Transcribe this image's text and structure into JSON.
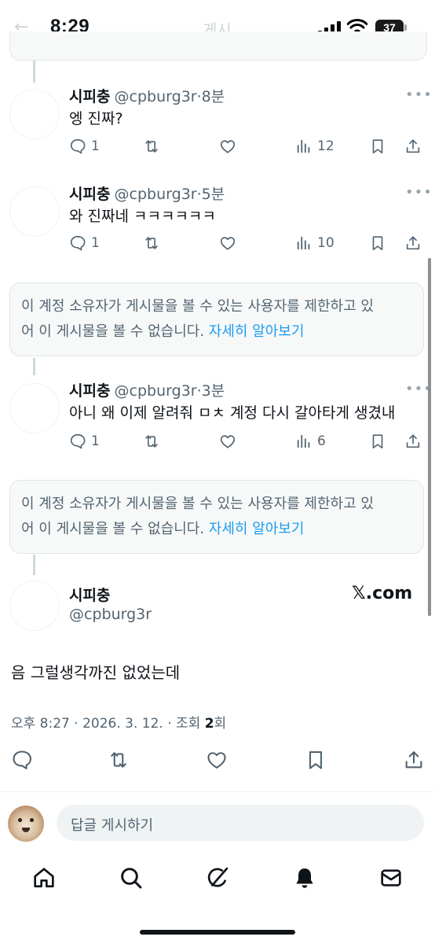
{
  "status_bar": {
    "time": "8:29",
    "battery": "37"
  },
  "header": {
    "title": "게시"
  },
  "replies": [
    {
      "name": "시피충",
      "handle": "@cpburg3r",
      "time": "8분",
      "text": "엥 진짜?",
      "replies": "1",
      "retweets": "",
      "likes": "",
      "views": "12"
    },
    {
      "name": "시피충",
      "handle": "@cpburg3r",
      "time": "5분",
      "text": "와 진짜네 ㅋㅋㅋㅋㅋㅋ",
      "replies": "1",
      "retweets": "",
      "likes": "",
      "views": "10"
    },
    {
      "name": "시피충",
      "handle": "@cpburg3r",
      "time": "3분",
      "text": "아니 왜 이제 알려줘 ㅁㅊ 계정 다시 갈아타게 생겼내",
      "replies": "1",
      "retweets": "",
      "likes": "",
      "views": "6"
    }
  ],
  "restricted_notice": {
    "line1": "이 계정 소유자가 게시물을 볼 수 있는 사용자를 제한하고 있",
    "line2_prefix": "어 이 게시물을 볼 수 없습니다. ",
    "link": "자세히 알아보기"
  },
  "main_post": {
    "name": "시피충",
    "handle": "@cpburg3r",
    "source": "𝕏.com",
    "text": "음 그럴생각까진 없었는데",
    "meta_prefix": "오후 8:27 · 2026. 3. 12. · 조회 ",
    "views": "2",
    "meta_suffix": "회"
  },
  "reply_box": {
    "placeholder": "답글 게시하기"
  },
  "bottom_nav": [
    "home-icon",
    "search-icon",
    "grok-icon",
    "notifications-icon",
    "messages-icon"
  ]
}
